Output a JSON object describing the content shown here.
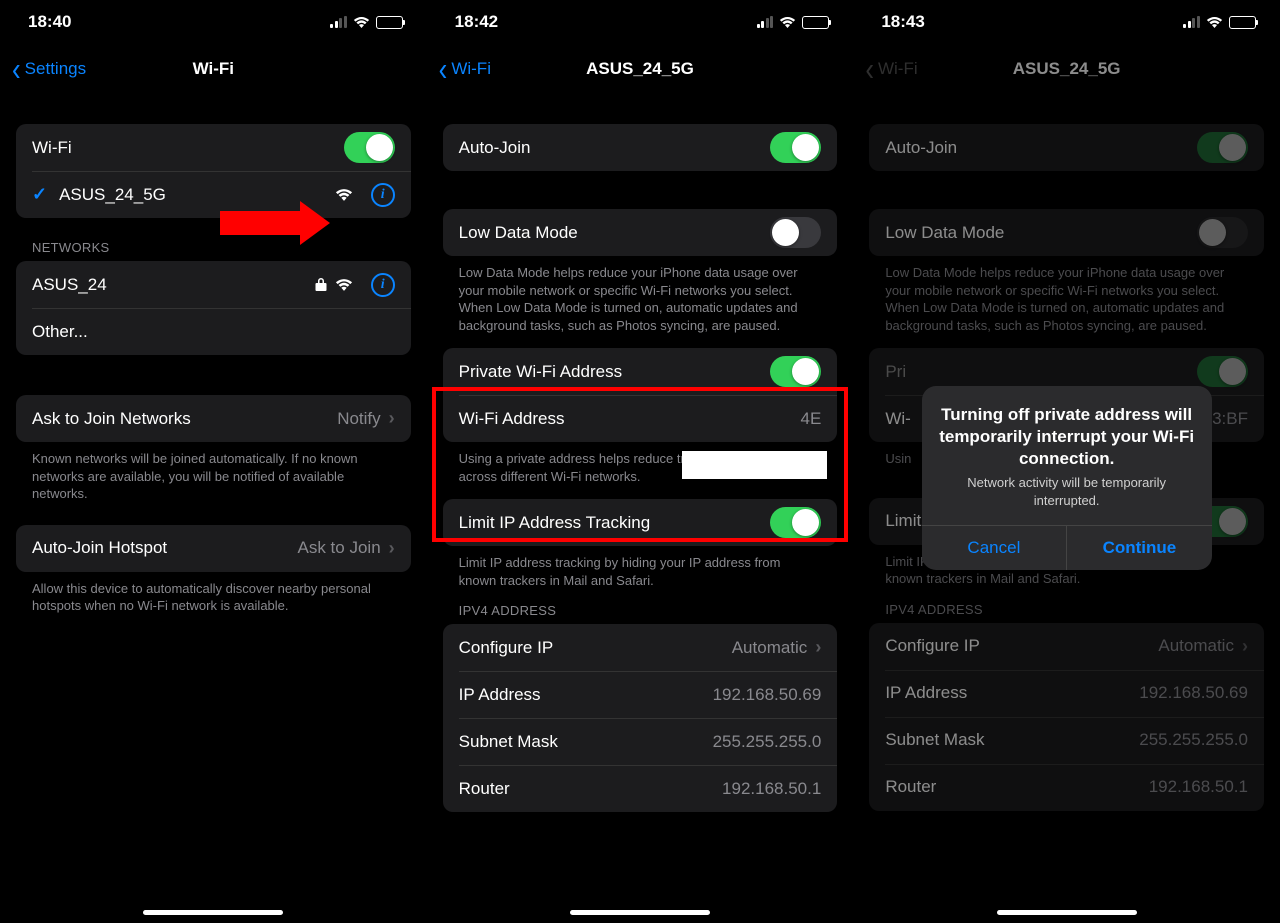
{
  "screen1": {
    "time": "18:40",
    "back": "Settings",
    "title": "Wi-Fi",
    "wifi_label": "Wi-Fi",
    "connected_network": "ASUS_24_5G",
    "networks_header": "NETWORKS",
    "network1": "ASUS_24",
    "other": "Other...",
    "ask_join_label": "Ask to Join Networks",
    "ask_join_value": "Notify",
    "ask_join_footer": "Known networks will be joined automatically. If no known networks are available, you will be notified of available networks.",
    "auto_hotspot_label": "Auto-Join Hotspot",
    "auto_hotspot_value": "Ask to Join",
    "auto_hotspot_footer": "Allow this device to automatically discover nearby personal hotspots when no Wi-Fi network is available."
  },
  "screen2": {
    "time": "18:42",
    "back": "Wi-Fi",
    "title": "ASUS_24_5G",
    "auto_join": "Auto-Join",
    "low_data": "Low Data Mode",
    "low_data_footer": "Low Data Mode helps reduce your iPhone data usage over your mobile network or specific Wi-Fi networks you select. When Low Data Mode is turned on, automatic updates and background tasks, such as Photos syncing, are paused.",
    "private_addr": "Private Wi-Fi Address",
    "wifi_addr_label": "Wi-Fi Address",
    "wifi_addr_prefix": "4E",
    "private_footer": "Using a private address helps reduce tracking of your iPhone across different Wi-Fi networks.",
    "limit_ip": "Limit IP Address Tracking",
    "limit_ip_footer": "Limit IP address tracking by hiding your IP address from known trackers in Mail and Safari.",
    "ipv4_header": "IPV4 ADDRESS",
    "configure_ip": "Configure IP",
    "configure_ip_val": "Automatic",
    "ip_label": "IP Address",
    "ip_val": "192.168.50.69",
    "subnet_label": "Subnet Mask",
    "subnet_val": "255.255.255.0",
    "router_label": "Router",
    "router_val": "192.168.50.1"
  },
  "screen3": {
    "time": "18:43",
    "back": "Wi-Fi",
    "title": "ASUS_24_5G",
    "wifi_addr_suffix": "3:BF",
    "dialog_title": "Turning off private address will temporarily interrupt your Wi-Fi connection.",
    "dialog_msg": "Network activity will be temporarily interrupted.",
    "cancel": "Cancel",
    "continue": "Continue"
  },
  "shared": {
    "wifi_label2": "Wi-"
  }
}
